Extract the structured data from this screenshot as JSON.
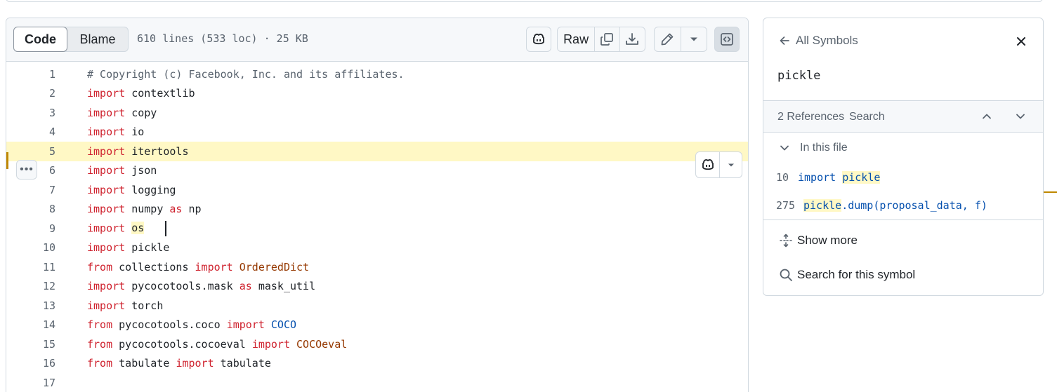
{
  "toolbar": {
    "code_tab": "Code",
    "blame_tab": "Blame",
    "file_info": "610 lines (533 loc) · 25 KB",
    "raw_label": "Raw"
  },
  "code_lines": [
    {
      "n": "1",
      "parts": [
        {
          "t": "# Copyright (c) Facebook, Inc. and its affiliates.",
          "c": "cm"
        }
      ]
    },
    {
      "n": "2",
      "parts": [
        {
          "t": "import",
          "c": "kw"
        },
        {
          "t": " contextlib",
          "c": ""
        }
      ]
    },
    {
      "n": "3",
      "parts": [
        {
          "t": "import",
          "c": "kw"
        },
        {
          "t": " copy",
          "c": ""
        }
      ]
    },
    {
      "n": "4",
      "parts": [
        {
          "t": "import",
          "c": "kw"
        },
        {
          "t": " io",
          "c": ""
        }
      ]
    },
    {
      "n": "5",
      "parts": [
        {
          "t": "import",
          "c": "kw"
        },
        {
          "t": " itertools",
          "c": ""
        }
      ]
    },
    {
      "n": "6",
      "parts": [
        {
          "t": "import",
          "c": "kw"
        },
        {
          "t": " json",
          "c": ""
        }
      ]
    },
    {
      "n": "7",
      "parts": [
        {
          "t": "import",
          "c": "kw"
        },
        {
          "t": " logging",
          "c": ""
        }
      ]
    },
    {
      "n": "8",
      "parts": [
        {
          "t": "import",
          "c": "kw"
        },
        {
          "t": " numpy ",
          "c": ""
        },
        {
          "t": "as",
          "c": "kw"
        },
        {
          "t": " np",
          "c": ""
        }
      ]
    },
    {
      "n": "9",
      "parts": [
        {
          "t": "import",
          "c": "kw"
        },
        {
          "t": " ",
          "c": ""
        },
        {
          "t": "os",
          "c": "sym-hl"
        }
      ]
    },
    {
      "n": "10",
      "parts": [
        {
          "t": "import",
          "c": "kw"
        },
        {
          "t": " pickle",
          "c": ""
        }
      ]
    },
    {
      "n": "11",
      "parts": [
        {
          "t": "from",
          "c": "kw"
        },
        {
          "t": " collections ",
          "c": ""
        },
        {
          "t": "import",
          "c": "kw"
        },
        {
          "t": " ",
          "c": ""
        },
        {
          "t": "OrderedDict",
          "c": "cls"
        }
      ]
    },
    {
      "n": "12",
      "parts": [
        {
          "t": "import",
          "c": "kw"
        },
        {
          "t": " pycocotools.mask ",
          "c": ""
        },
        {
          "t": "as",
          "c": "kw"
        },
        {
          "t": " mask_util",
          "c": ""
        }
      ]
    },
    {
      "n": "13",
      "parts": [
        {
          "t": "import",
          "c": "kw"
        },
        {
          "t": " torch",
          "c": ""
        }
      ]
    },
    {
      "n": "14",
      "parts": [
        {
          "t": "from",
          "c": "kw"
        },
        {
          "t": " pycocotools.coco ",
          "c": ""
        },
        {
          "t": "import",
          "c": "kw"
        },
        {
          "t": " ",
          "c": ""
        },
        {
          "t": "COCO",
          "c": "cb"
        }
      ]
    },
    {
      "n": "15",
      "parts": [
        {
          "t": "from",
          "c": "kw"
        },
        {
          "t": " pycocotools.cocoeval ",
          "c": ""
        },
        {
          "t": "import",
          "c": "kw"
        },
        {
          "t": " ",
          "c": ""
        },
        {
          "t": "COCOeval",
          "c": "cls"
        }
      ]
    },
    {
      "n": "16",
      "parts": [
        {
          "t": "from",
          "c": "kw"
        },
        {
          "t": " tabulate ",
          "c": ""
        },
        {
          "t": "import",
          "c": "kw"
        },
        {
          "t": " tabulate",
          "c": ""
        }
      ]
    },
    {
      "n": "17",
      "parts": []
    }
  ],
  "highlighted_line": "5",
  "cursor_line": "9",
  "symbols": {
    "back_label": "All Symbols",
    "symbol_name": "pickle",
    "references_count": "2 References",
    "search_label": "Search",
    "in_file_label": "In this file",
    "references": [
      {
        "line": "10",
        "before": "import ",
        "match": "pickle",
        "after": ""
      },
      {
        "line": "275",
        "before": "",
        "match": "pickle",
        "after": ".dump(proposal_data, f)"
      }
    ],
    "show_more": "Show more",
    "search_symbol": "Search for this symbol"
  }
}
